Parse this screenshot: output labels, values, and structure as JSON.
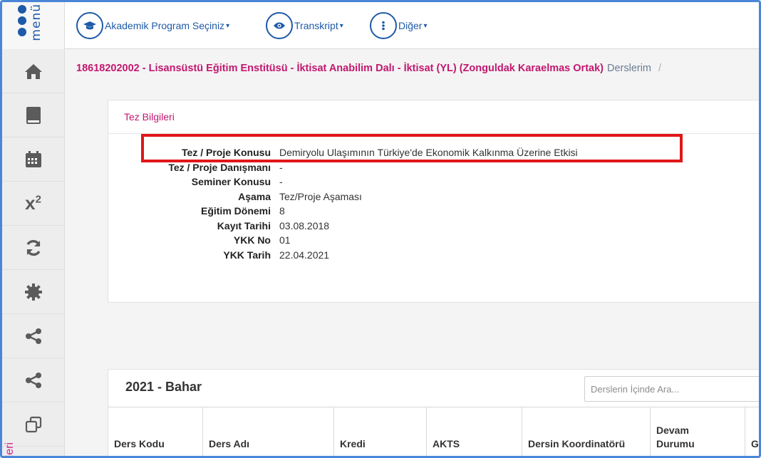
{
  "topbar": {
    "logo_word": "menü",
    "menus": [
      {
        "label": "Akademik Program Seçiniz",
        "caret": "▾"
      },
      {
        "label": "Transkript",
        "caret": "▾"
      },
      {
        "label": "Diğer",
        "caret": "▾"
      }
    ]
  },
  "breadcrumb": {
    "main": "18618202002 - Lisansüstü Eğitim Enstitüsü - İktisat Anabilim Dalı - İktisat (YL) (Zonguldak Karaelmas Ortak)",
    "current": "Derslerim",
    "separator": "/"
  },
  "sidebar": {
    "items": [
      "home-icon",
      "book-icon",
      "calendar-icon",
      "superscript-icon",
      "refresh-icon",
      "gear-icon",
      "share-icon",
      "share-icon",
      "copy-icon"
    ],
    "vertical_label": "leri"
  },
  "thesis": {
    "title": "Tez Bilgileri",
    "rows": [
      {
        "label": "Tez / Proje Konusu",
        "value": "Demiryolu Ulaşımının Türkiye'de Ekonomik Kalkınma Üzerine Etkisi"
      },
      {
        "label": "Tez / Proje Danışmanı",
        "value": "-"
      },
      {
        "label": "Seminer Konusu",
        "value": "-"
      },
      {
        "label": "Aşama",
        "value": "Tez/Proje Aşaması"
      },
      {
        "label": "Eğitim Dönemi",
        "value": "8"
      },
      {
        "label": "Kayıt Tarihi",
        "value": "03.08.2018"
      },
      {
        "label": "YKK No",
        "value": "01"
      },
      {
        "label": "YKK Tarih",
        "value": "22.04.2021"
      }
    ]
  },
  "courses": {
    "term": "2021 - Bahar",
    "search_placeholder": "Derslerin İçinde Ara...",
    "columns": [
      "Ders Kodu",
      "Ders Adı",
      "Kredi",
      "AKTS",
      "Dersin Koordinatörü",
      "Devam Durumu",
      "Ge"
    ]
  },
  "colors": {
    "brand": "#1e5aa8",
    "accent": "#c2176f",
    "highlight": "#e0171a"
  }
}
